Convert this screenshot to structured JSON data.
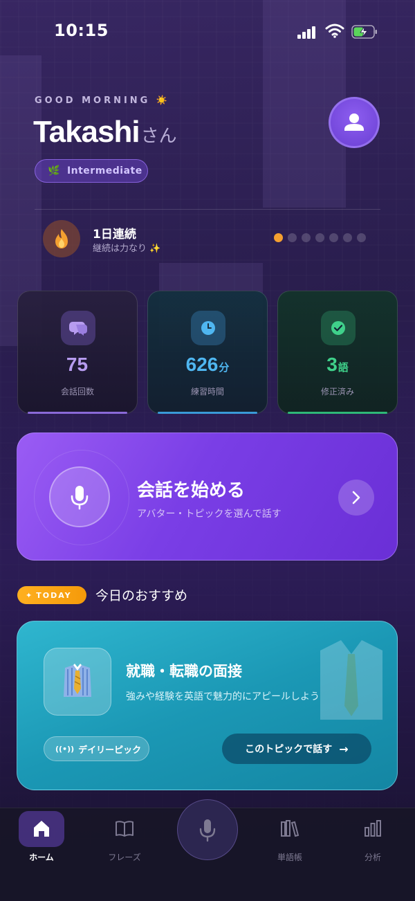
{
  "status_bar": {
    "time": "10:15"
  },
  "header": {
    "greeting": "GOOD MORNING",
    "greeting_emoji": "☀️",
    "user_name": "Takashi",
    "honorific": "さん",
    "level": "Intermediate"
  },
  "streak": {
    "title": "1日連続",
    "subtitle": "継続は力なり ✨",
    "active_dots": 1,
    "total_dots": 7
  },
  "stats": [
    {
      "value": "75",
      "unit": "",
      "label": "会話回数",
      "color": "#b79cf0",
      "icon": "chat-bubbles-icon"
    },
    {
      "value": "626",
      "unit": "分",
      "label": "練習時間",
      "color": "#4fb6f0",
      "icon": "clock-icon"
    },
    {
      "value": "3",
      "unit": "語",
      "label": "修正済み",
      "color": "#3fd08a",
      "icon": "check-circle-icon"
    }
  ],
  "cta": {
    "title": "会話を始める",
    "subtitle": "アバター・トピックを選んで話す"
  },
  "today": {
    "badge": "TODAY",
    "title": "今日のおすすめ"
  },
  "topic": {
    "title": "就職・転職の面接",
    "description": "強みや経験を英語で魅力的にアピールしよう",
    "tag": "デイリーピック",
    "button": "このトピックで話す",
    "icon": "necktie-shirt-icon"
  },
  "tabs": [
    {
      "label": "ホーム",
      "active": true,
      "icon": "home-icon"
    },
    {
      "label": "フレーズ",
      "active": false,
      "icon": "book-icon"
    },
    {
      "label": "単語帳",
      "active": false,
      "icon": "books-icon"
    },
    {
      "label": "分析",
      "active": false,
      "icon": "bar-chart-icon"
    }
  ],
  "colors": {
    "accent_purple": "#7a3ee6",
    "accent_teal": "#1b98b5",
    "streak_orange": "#f5a030"
  }
}
